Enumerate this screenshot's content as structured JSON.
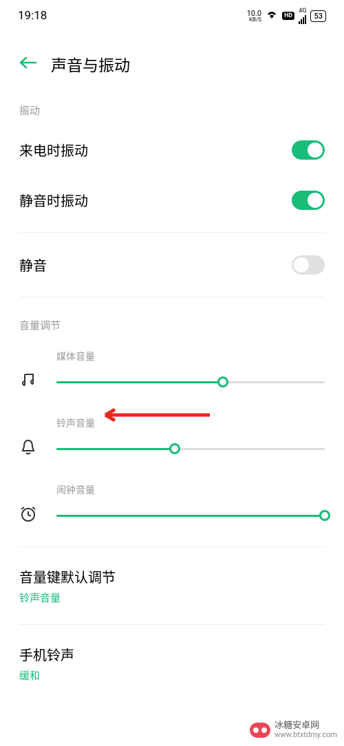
{
  "status": {
    "time": "19:18",
    "speed_value": "10.0",
    "speed_unit": "KB/S",
    "hd": "HD",
    "net": "4G",
    "battery": "53"
  },
  "header": {
    "title": "声音与振动"
  },
  "sections": {
    "vibration_label": "振动",
    "volume_label": "音量调节"
  },
  "toggles": {
    "vibrate_on_ring": {
      "label": "来电时振动",
      "on": true
    },
    "vibrate_on_silent": {
      "label": "静音时振动",
      "on": true
    },
    "silent": {
      "label": "静音",
      "on": false
    }
  },
  "sliders": {
    "media": {
      "label": "媒体音量",
      "percent": 62
    },
    "ring": {
      "label": "铃声音量",
      "percent": 44
    },
    "alarm": {
      "label": "闹钟音量",
      "percent": 100
    }
  },
  "volume_key": {
    "label": "音量键默认调节",
    "value": "铃声音量"
  },
  "ringtone": {
    "label": "手机铃声",
    "value": "缓和"
  },
  "watermark": {
    "brand": "冰糖安卓网",
    "url": "www.btxtdmy.com"
  }
}
